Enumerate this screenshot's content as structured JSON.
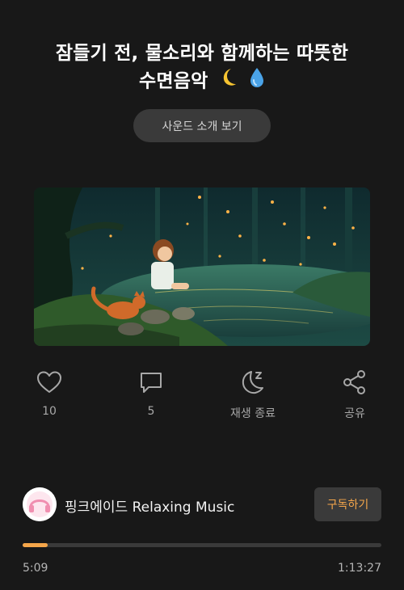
{
  "title": {
    "line1": "잠들기 전, 물소리와 함께하는 따뜻한",
    "line2": "수면음악"
  },
  "intro_button_label": "사운드 소개 보기",
  "actions": {
    "like": {
      "icon": "heart-icon",
      "label": "10"
    },
    "comment": {
      "icon": "comment-icon",
      "label": "5"
    },
    "sleep_timer": {
      "icon": "moon-sleep-icon",
      "label": "재생 종료"
    },
    "share": {
      "icon": "share-icon",
      "label": "공유"
    }
  },
  "channel": {
    "name": "핑크에이드 Relaxing Music",
    "subscribe_label": "구독하기"
  },
  "player": {
    "current_time": "5:09",
    "total_time": "1:13:27",
    "progress_fraction": 0.07
  },
  "colors": {
    "background": "#181818",
    "accent": "#f5a64a",
    "muted_text": "#a8a8a8"
  }
}
